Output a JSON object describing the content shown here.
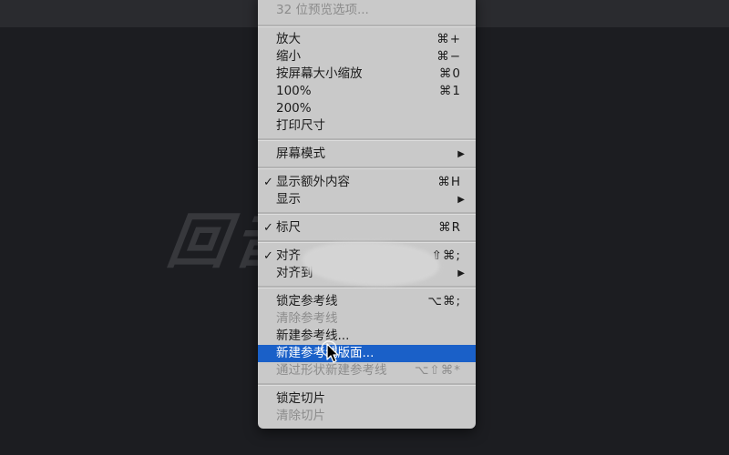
{
  "watermark": {
    "text": "回音 会"
  },
  "menu": {
    "items": [
      {
        "label": "32 位预览选项...",
        "disabled": true
      },
      {
        "label": "放大",
        "shortcut": "⌘+"
      },
      {
        "label": "缩小",
        "shortcut": "⌘−"
      },
      {
        "label": "按屏幕大小缩放",
        "shortcut": "⌘0"
      },
      {
        "label": "100%",
        "shortcut": "⌘1"
      },
      {
        "label": "200%"
      },
      {
        "label": "打印尺寸"
      },
      {
        "label": "屏幕模式",
        "submenu": "▶"
      },
      {
        "label": "显示额外内容",
        "shortcut": "⌘H",
        "check": "✓"
      },
      {
        "label": "显示",
        "submenu": "▶"
      },
      {
        "label": "标尺",
        "shortcut": "⌘R",
        "check": "✓"
      },
      {
        "label": "对齐",
        "shortcut": "⇧⌘;",
        "check": "✓"
      },
      {
        "label": "对齐到",
        "submenu": "▶"
      },
      {
        "label": "锁定参考线",
        "shortcut": "⌥⌘;"
      },
      {
        "label": "清除参考线",
        "disabled": true
      },
      {
        "label": "新建参考线..."
      },
      {
        "label": "新建参考线版面...",
        "highlight": true
      },
      {
        "label": "通过形状新建参考线",
        "shortcut": "⌥⇧⌘*",
        "disabled": true
      },
      {
        "label": "锁定切片"
      },
      {
        "label": "清除切片",
        "disabled": true
      }
    ]
  }
}
